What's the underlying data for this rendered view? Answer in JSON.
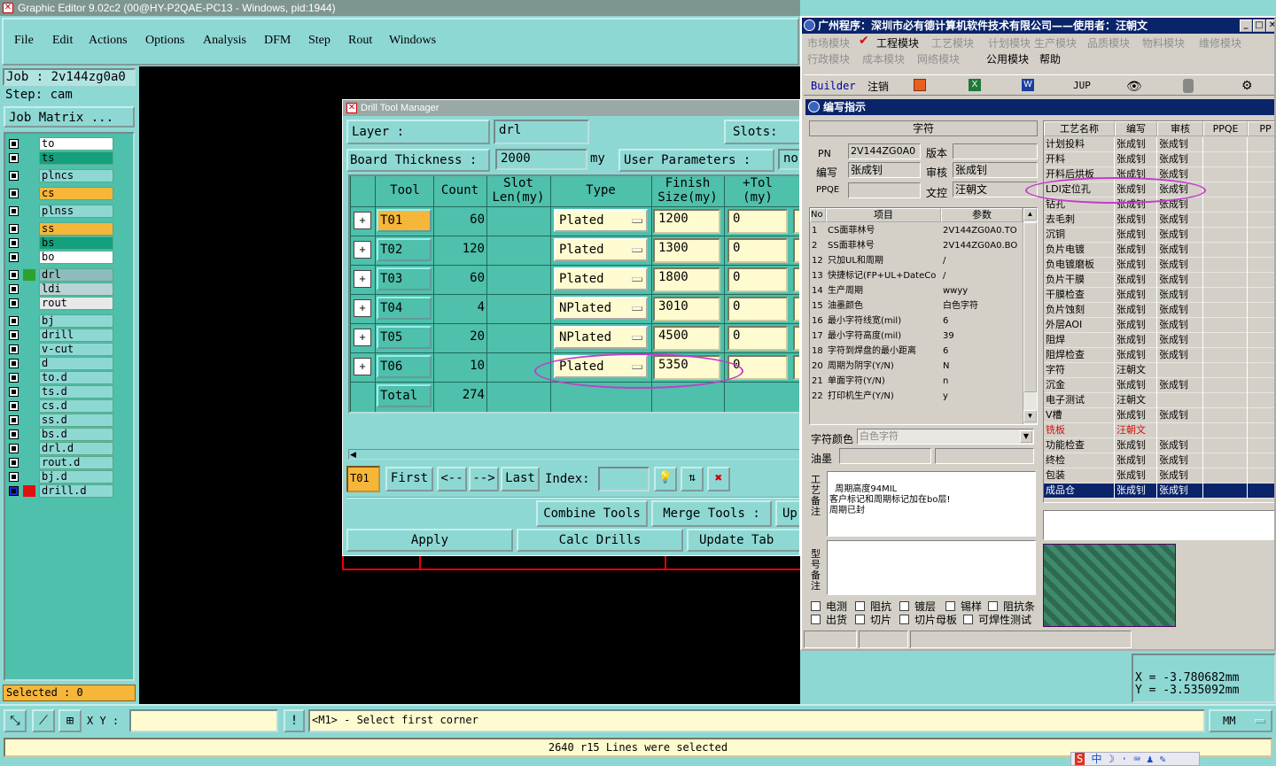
{
  "app": {
    "title": "Graphic Editor 9.02c2 (00@HY-P2QAE-PC13 - Windows, pid:1944)"
  },
  "menu": [
    "File",
    "Edit",
    "Actions",
    "Options",
    "Analysis",
    "DFM",
    "Step",
    "Rout",
    "Windows"
  ],
  "left": {
    "job": "Job : 2v144zg0a0",
    "step": "Step: cam",
    "job_matrix": "Job Matrix ...",
    "selected": "Selected : 0",
    "layers": [
      {
        "name": "to",
        "bg": "#ffffff"
      },
      {
        "name": "ts",
        "bg": "#14a07c"
      },
      {
        "name": "plncs",
        "bg": "#8ed8d4"
      },
      {
        "name": "cs",
        "bg": "#f6b63a"
      },
      {
        "name": "plnss",
        "bg": "#8ed8d4"
      },
      {
        "name": "ss",
        "bg": "#f6b63a"
      },
      {
        "name": "bs",
        "bg": "#14a07c"
      },
      {
        "name": "bo",
        "bg": "#ffffff"
      },
      {
        "name": "drl",
        "bg": "#8ebcbc"
      },
      {
        "name": "ldi",
        "bg": "#b8d4d4"
      },
      {
        "name": "rout",
        "bg": "#e8e8e8"
      },
      {
        "name": "bj",
        "bg": "#8ed8d4"
      },
      {
        "name": "drill",
        "bg": "#8ed8d4"
      },
      {
        "name": "v-cut",
        "bg": "#8ed8d4"
      },
      {
        "name": "d",
        "bg": "#8ed8d4"
      },
      {
        "name": "to.d",
        "bg": "#8ed8d4"
      },
      {
        "name": "ts.d",
        "bg": "#8ed8d4"
      },
      {
        "name": "cs.d",
        "bg": "#8ed8d4"
      },
      {
        "name": "ss.d",
        "bg": "#8ed8d4"
      },
      {
        "name": "bs.d",
        "bg": "#8ed8d4"
      },
      {
        "name": "drl.d",
        "bg": "#8ed8d4"
      },
      {
        "name": "rout.d",
        "bg": "#8ed8d4"
      },
      {
        "name": "bj.d",
        "bg": "#8ed8d4"
      },
      {
        "name": "drill.d",
        "bg": "#8ed8d4"
      }
    ]
  },
  "dtm": {
    "title": "Drill Tool Manager",
    "layer_label": "Layer      :",
    "layer_value": "drl",
    "slots_label": "Slots:",
    "board_label": "Board Thickness :",
    "board_value": "2000",
    "board_unit": "my",
    "user_params": "User Parameters :",
    "user_value": "no",
    "headers": [
      "Tool",
      "Count",
      "Slot Len(my)",
      "Type",
      "Finish Size(my)",
      "+Tol (my)"
    ],
    "rows": [
      {
        "tool": "T01",
        "count": "60",
        "type": "Plated",
        "size": "1200",
        "tol": "0"
      },
      {
        "tool": "T02",
        "count": "120",
        "type": "Plated",
        "size": "1300",
        "tol": "0"
      },
      {
        "tool": "T03",
        "count": "60",
        "type": "Plated",
        "size": "1800",
        "tol": "0"
      },
      {
        "tool": "T04",
        "count": "4",
        "type": "NPlated",
        "size": "3010",
        "tol": "0"
      },
      {
        "tool": "T05",
        "count": "20",
        "type": "NPlated",
        "size": "4500",
        "tol": "0"
      },
      {
        "tool": "T06",
        "count": "10",
        "type": "Plated",
        "size": "5350",
        "tol": "0"
      }
    ],
    "total_label": "Total",
    "total_value": "274",
    "nav": {
      "current": "T01",
      "first": "First",
      "prev": "<--",
      "next": "-->",
      "last": "Last",
      "index": "Index:"
    },
    "combine": "Combine Tools",
    "merge": "Merge Tools :",
    "up": "Up",
    "apply": "Apply",
    "calc": "Calc Drills",
    "update": "Update Tab"
  },
  "bottom": {
    "xy_label": "X Y :",
    "prompt": "<M1> - Select first corner",
    "status": "2640 r15 Lines were selected",
    "unit": "MM",
    "coord_x": "X = -3.780682mm",
    "coord_y": "Y = -3.535092mm"
  },
  "cn": {
    "title": "广州程序：深圳市必有德计算机软件技术有限公司——使用者：汪朝文",
    "menu1": [
      "市场模块",
      "工程模块",
      "工艺模块",
      "计划模块",
      "生产模块",
      "品质模块",
      "物料模块",
      "维修模块"
    ],
    "menu2": [
      "行政模块",
      "成本模块",
      "网络模块",
      "公用模块",
      "帮助"
    ],
    "tb": [
      "Builder",
      "注销",
      "JUP"
    ],
    "sub_title": "编写指示",
    "section": "字符",
    "pn_label": "PN",
    "pn_value": "2V144ZG0A0",
    "ver_label": "版本",
    "ver_value": "",
    "writer_label": "编写",
    "writer_value": "张成钊",
    "auditor_label": "审核",
    "auditor_value": "张成钊",
    "ppqe_label": "PPQE",
    "ppqe_value": "",
    "doc_label": "文控",
    "doc_value": "汪朝文",
    "param_headers": [
      "No",
      "项目",
      "参数"
    ],
    "params": [
      {
        "no": "1",
        "item": "CS面菲林号",
        "val": "2V144ZG0A0.TO"
      },
      {
        "no": "2",
        "item": "SS面菲林号",
        "val": "2V144ZG0A0.BO"
      },
      {
        "no": "12",
        "item": "只加UL和周期",
        "val": "/"
      },
      {
        "no": "13",
        "item": "快捷标记(FP+UL+DateCo",
        "val": "/"
      },
      {
        "no": "14",
        "item": "生产周期",
        "val": "wwyy"
      },
      {
        "no": "15",
        "item": "油墨颜色",
        "val": "白色字符"
      },
      {
        "no": "16",
        "item": "最小字符线宽(mil)",
        "val": "6"
      },
      {
        "no": "17",
        "item": "最小字符高度(mil)",
        "val": "39"
      },
      {
        "no": "18",
        "item": "字符到焊盘的最小距离",
        "val": "6"
      },
      {
        "no": "20",
        "item": "周期为阴字(Y/N)",
        "val": "N"
      },
      {
        "no": "21",
        "item": "单面字符(Y/N)",
        "val": "n"
      },
      {
        "no": "22",
        "item": "打印机生产(Y/N)",
        "val": "y"
      }
    ],
    "color_label": "字符颜色",
    "color_value": "白色字符",
    "ink_label": "油墨",
    "notes_label": "工艺备注",
    "notes": "周期高度94MIL\n客户标记和周期标记加在bo层!\n周期已封",
    "model_label": "型号备注",
    "checks1": [
      "电测",
      "阻抗",
      "镀层",
      "锡样",
      "阻抗条"
    ],
    "checks2": [
      "出货",
      "切片",
      "切片母板",
      "可焊性测试"
    ],
    "proc_headers": [
      "工艺名称",
      "编写",
      "审核",
      "PPQE",
      "PP"
    ],
    "procs": [
      {
        "n": "计划投料",
        "w": "张成钊",
        "a": "张成钊"
      },
      {
        "n": "开料",
        "w": "张成钊",
        "a": "张成钊"
      },
      {
        "n": "开料后烘板",
        "w": "张成钊",
        "a": "张成钊"
      },
      {
        "n": "LDI定位孔",
        "w": "张成钊",
        "a": "张成钊"
      },
      {
        "n": "钻孔",
        "w": "张成钊",
        "a": "张成钊"
      },
      {
        "n": "去毛刺",
        "w": "张成钊",
        "a": "张成钊"
      },
      {
        "n": "沉铜",
        "w": "张成钊",
        "a": "张成钊"
      },
      {
        "n": "负片电镀",
        "w": "张成钊",
        "a": "张成钊"
      },
      {
        "n": "负电镀磨板",
        "w": "张成钊",
        "a": "张成钊"
      },
      {
        "n": "负片干膜",
        "w": "张成钊",
        "a": "张成钊"
      },
      {
        "n": "干膜检查",
        "w": "张成钊",
        "a": "张成钊"
      },
      {
        "n": "负片蚀刻",
        "w": "张成钊",
        "a": "张成钊"
      },
      {
        "n": "外层AOI",
        "w": "张成钊",
        "a": "张成钊"
      },
      {
        "n": "阻焊",
        "w": "张成钊",
        "a": "张成钊"
      },
      {
        "n": "阻焊检查",
        "w": "张成钊",
        "a": "张成钊"
      },
      {
        "n": "字符",
        "w": "汪朝文",
        "a": ""
      },
      {
        "n": "沉金",
        "w": "张成钊",
        "a": "张成钊"
      },
      {
        "n": "电子测试",
        "w": "汪朝文",
        "a": ""
      },
      {
        "n": "V槽",
        "w": "张成钊",
        "a": "张成钊"
      },
      {
        "n": "铣板",
        "w": "汪朝文",
        "a": "",
        "red": true
      },
      {
        "n": "功能检查",
        "w": "张成钊",
        "a": "张成钊"
      },
      {
        "n": "终检",
        "w": "张成钊",
        "a": "张成钊"
      },
      {
        "n": "包装",
        "w": "张成钊",
        "a": "张成钊"
      },
      {
        "n": "成品仓",
        "w": "张成钊",
        "a": "张成钊",
        "sel": true
      }
    ],
    "ime": "中"
  }
}
